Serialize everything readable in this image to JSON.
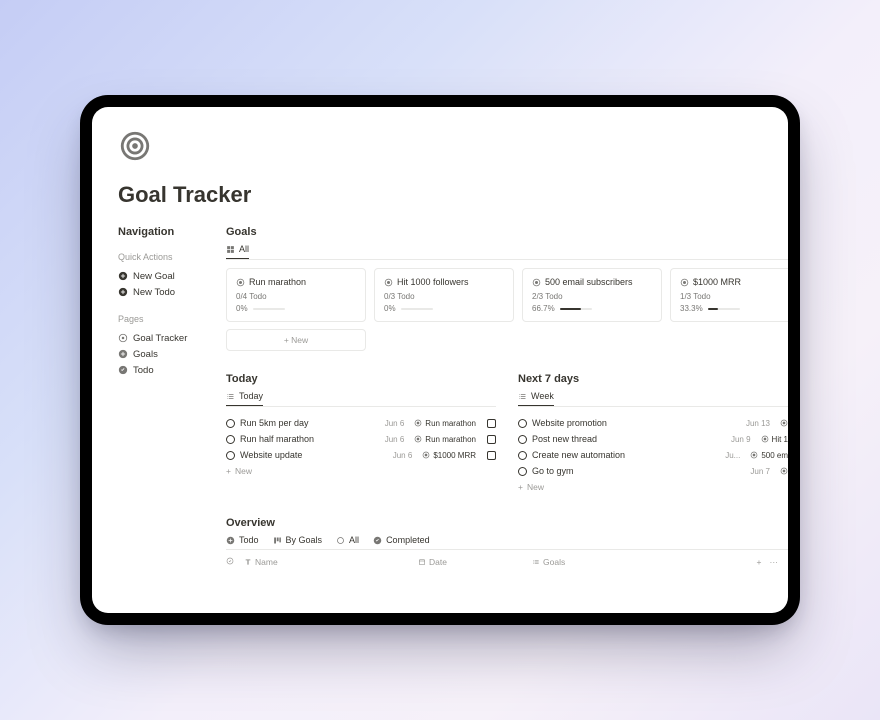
{
  "page": {
    "title": "Goal Tracker"
  },
  "sidebar": {
    "nav_heading": "Navigation",
    "quick_heading": "Quick Actions",
    "quick": [
      {
        "label": "New Goal"
      },
      {
        "label": "New Todo"
      }
    ],
    "pages_heading": "Pages",
    "pages": [
      {
        "label": "Goal Tracker"
      },
      {
        "label": "Goals"
      },
      {
        "label": "Todo"
      }
    ]
  },
  "goals": {
    "heading": "Goals",
    "tab": "All",
    "cards": [
      {
        "title": "Run marathon",
        "sub": "0/4 Todo",
        "pct_label": "0%",
        "pct": 0
      },
      {
        "title": "Hit 1000 followers",
        "sub": "0/3 Todo",
        "pct_label": "0%",
        "pct": 0
      },
      {
        "title": "500 email subscribers",
        "sub": "2/3 Todo",
        "pct_label": "66.7%",
        "pct": 66.7
      },
      {
        "title": "$1000 MRR",
        "sub": "1/3 Todo",
        "pct_label": "33.3%",
        "pct": 33.3
      }
    ],
    "new_label": "+   New"
  },
  "today": {
    "heading": "Today",
    "tab": "Today",
    "rows": [
      {
        "name": "Run 5km per day",
        "date": "Jun 6",
        "goal": "Run marathon",
        "checkbox": true
      },
      {
        "name": "Run half marathon",
        "date": "Jun 6",
        "goal": "Run marathon",
        "checkbox": true
      },
      {
        "name": "Website update",
        "date": "Jun 6",
        "goal": "$1000 MRR",
        "checkbox": true
      }
    ],
    "new_label": "New"
  },
  "next7": {
    "heading": "Next 7 days",
    "tab": "Week",
    "rows": [
      {
        "name": "Website promotion",
        "date": "Jun 13",
        "goal": ""
      },
      {
        "name": "Post new thread",
        "date": "Jun 9",
        "goal": "Hit 1"
      },
      {
        "name": "Create new automation",
        "date": "Ju...",
        "goal": "500 em"
      },
      {
        "name": "Go to gym",
        "date": "Jun 7",
        "goal": ""
      }
    ],
    "new_label": "New"
  },
  "overview": {
    "heading": "Overview",
    "tabs": [
      {
        "label": "Todo"
      },
      {
        "label": "By Goals"
      },
      {
        "label": "All"
      },
      {
        "label": "Completed"
      }
    ],
    "columns": {
      "name": "Name",
      "date": "Date",
      "goals": "Goals"
    }
  }
}
